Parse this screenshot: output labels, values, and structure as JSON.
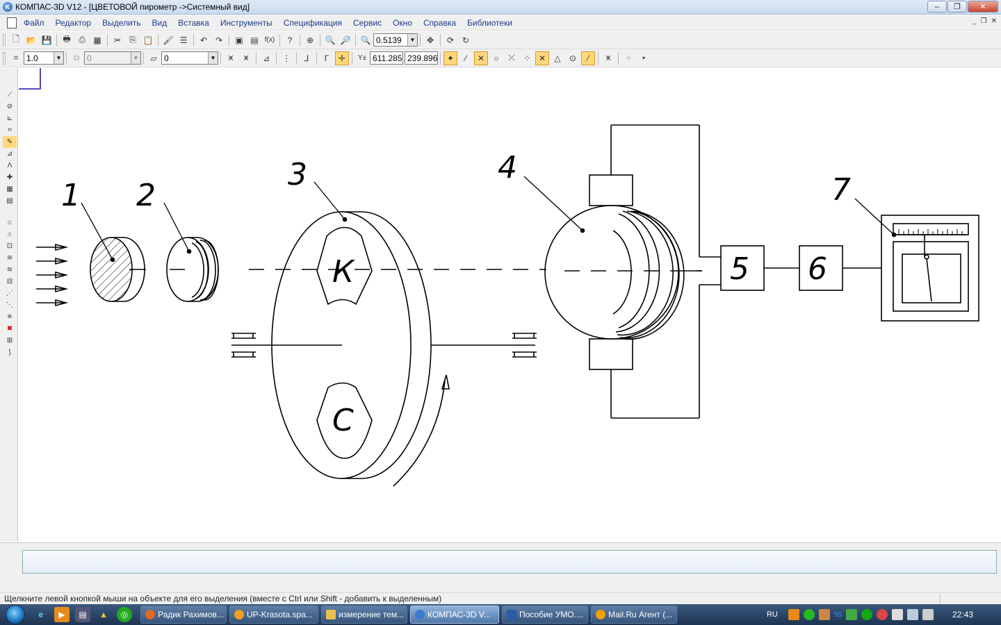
{
  "window": {
    "title": "КОМПАС-3D V12 - [ЦВЕТОВОЙ пирометр ->Системный вид]",
    "app_icon": "kompas-icon"
  },
  "menu": [
    "Файл",
    "Редактор",
    "Выделить",
    "Вид",
    "Вставка",
    "Инструменты",
    "Спецификация",
    "Сервис",
    "Окно",
    "Справка",
    "Библиотеки"
  ],
  "toolbar1": {
    "zoom_value": "0.5139",
    "fx_label": "f(x)"
  },
  "toolbar2": {
    "step_value": "1.0",
    "layer_value": "0",
    "style_value": "0",
    "coord_x": "611.285",
    "coord_y": "239.896"
  },
  "drawing": {
    "labels": [
      "1",
      "2",
      "3",
      "4",
      "5",
      "6",
      "7"
    ],
    "disk_letter_top": "К",
    "disk_letter_bottom": "С"
  },
  "status": {
    "hint": "Щелкните левой кнопкой мыши на объекте для его выделения (вместе с Ctrl или Shift - добавить к выделенным)"
  },
  "taskbar": {
    "tasks": [
      {
        "label": "Радик Рахимов...",
        "color": "#e06a20"
      },
      {
        "label": "UP-Krasota.spa...",
        "color": "#f0a020"
      },
      {
        "label": "измерение тем...",
        "color": "#e8c050"
      },
      {
        "label": "КОМПАС-3D V...",
        "color": "#3a7ad0"
      },
      {
        "label": "Пособие УМО....",
        "color": "#2a5aa8"
      },
      {
        "label": "Mail.Ru Агент (...",
        "color": "#f0a000"
      }
    ],
    "lang": "RU",
    "clock": "22:43",
    "tray_number": "55"
  },
  "colors": {
    "highlight": "#ffd87a",
    "selection_box": "#1010a0"
  }
}
